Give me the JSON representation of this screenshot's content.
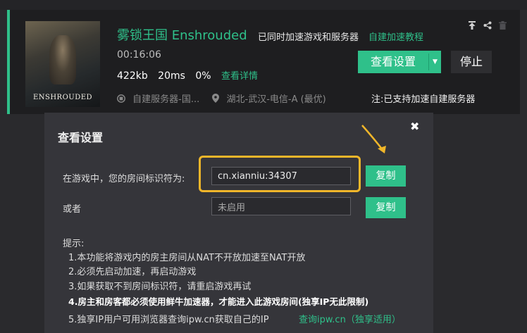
{
  "card": {
    "cover_logo": "ENSHROUDED",
    "game_title": "雾锁王国 Enshrouded",
    "description": "已同时加速游戏和服务器",
    "tutorial_link": "自建加速教程",
    "elapsed": "00:16:06",
    "speed": "422kb",
    "latency": "20ms",
    "loss": "0%",
    "details_link": "查看详情",
    "server_label": "自建服务器-国...",
    "location_label": "湖北-武汉-电信-A (最优)",
    "note": "注:已支持加速自建服务器",
    "settings_button": "查看设置",
    "stop_button": "停止",
    "icons": [
      "pin-top-icon",
      "share-icon",
      "trash-icon"
    ]
  },
  "dialog": {
    "title": "查看设置",
    "room_label": "在游戏中，您的房间标识符为:",
    "room_value": "cn.xianniu:34307",
    "or_label": "或者",
    "alt_value": "未启用",
    "copy_button": "复制",
    "tips_title": "提示:",
    "tips": [
      "1.本功能将游戏内的房主房间从NAT不开放加速至NAT开放",
      "2.必须先启动加速，再启动游戏",
      "3.如果获取不到房间标识符，请重启游戏再试",
      "4.房主和房客都必须使用鲜牛加速器，才能进入此游戏房间(独享IP无此限制)",
      "5.独享IP用户可用浏览器查询ipw.cn获取自己的IP"
    ],
    "ipw_link": "查询ipw.cn（独享适用）"
  },
  "colors": {
    "accent": "#2fc08a",
    "highlight": "#f0b62a",
    "background": "#2a2a2d",
    "dialog": "#35353a"
  }
}
